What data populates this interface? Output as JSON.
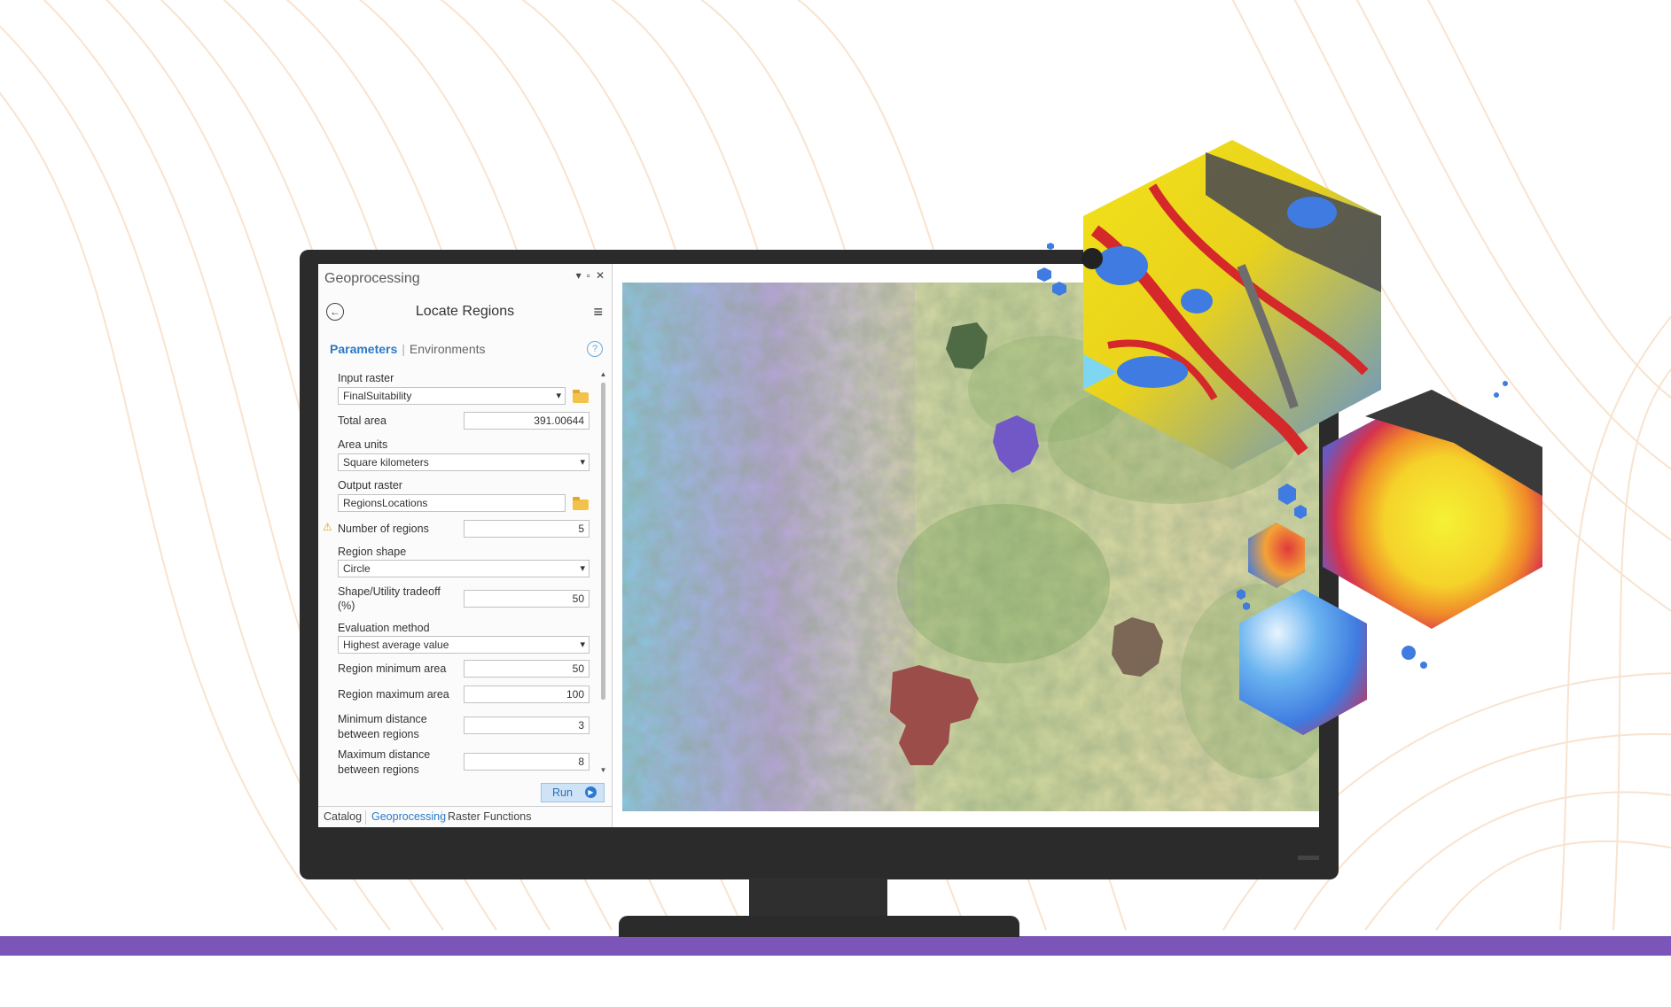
{
  "pane": {
    "title": "Geoprocessing",
    "tool_title": "Locate Regions",
    "tabs": {
      "parameters": "Parameters",
      "environments": "Environments"
    },
    "parameters": {
      "input_raster_label": "Input raster",
      "input_raster_value": "FinalSuitability",
      "total_area_label": "Total area",
      "total_area_value": "391.00644",
      "area_units_label": "Area units",
      "area_units_value": "Square kilometers",
      "output_raster_label": "Output raster",
      "output_raster_value": "RegionsLocations",
      "number_of_regions_label": "Number of regions",
      "number_of_regions_value": "5",
      "region_shape_label": "Region shape",
      "region_shape_value": "Circle",
      "tradeoff_label_line1": "Shape/Utility tradeoff",
      "tradeoff_label_line2": "(%)",
      "tradeoff_value": "50",
      "evaluation_method_label": "Evaluation method",
      "evaluation_method_value": "Highest average value",
      "region_min_area_label": "Region minimum area",
      "region_min_area_value": "50",
      "region_max_area_label": "Region maximum area",
      "region_max_area_value": "100",
      "min_distance_label_line1": "Minimum distance",
      "min_distance_label_line2": "between regions",
      "min_distance_value": "3",
      "max_distance_label_line1": "Maximum distance",
      "max_distance_label_line2": "between regions",
      "max_distance_value": "8"
    },
    "run_label": "Run",
    "bottom_tabs": [
      "Catalog",
      "Geoprocessing",
      "Raster Functions"
    ]
  },
  "colors": {
    "accent_blue": "#2a79c8",
    "purple_band": "#7b55b8",
    "region_dark_green": "#4f6b45",
    "region_purple": "#7257c7",
    "region_brown": "#7c6757",
    "region_red": "#9b4d4a"
  },
  "icons": [
    "back-arrow-icon",
    "menu-icon",
    "help-icon",
    "folder-icon",
    "warning-icon",
    "run-icon",
    "dock-icons"
  ]
}
